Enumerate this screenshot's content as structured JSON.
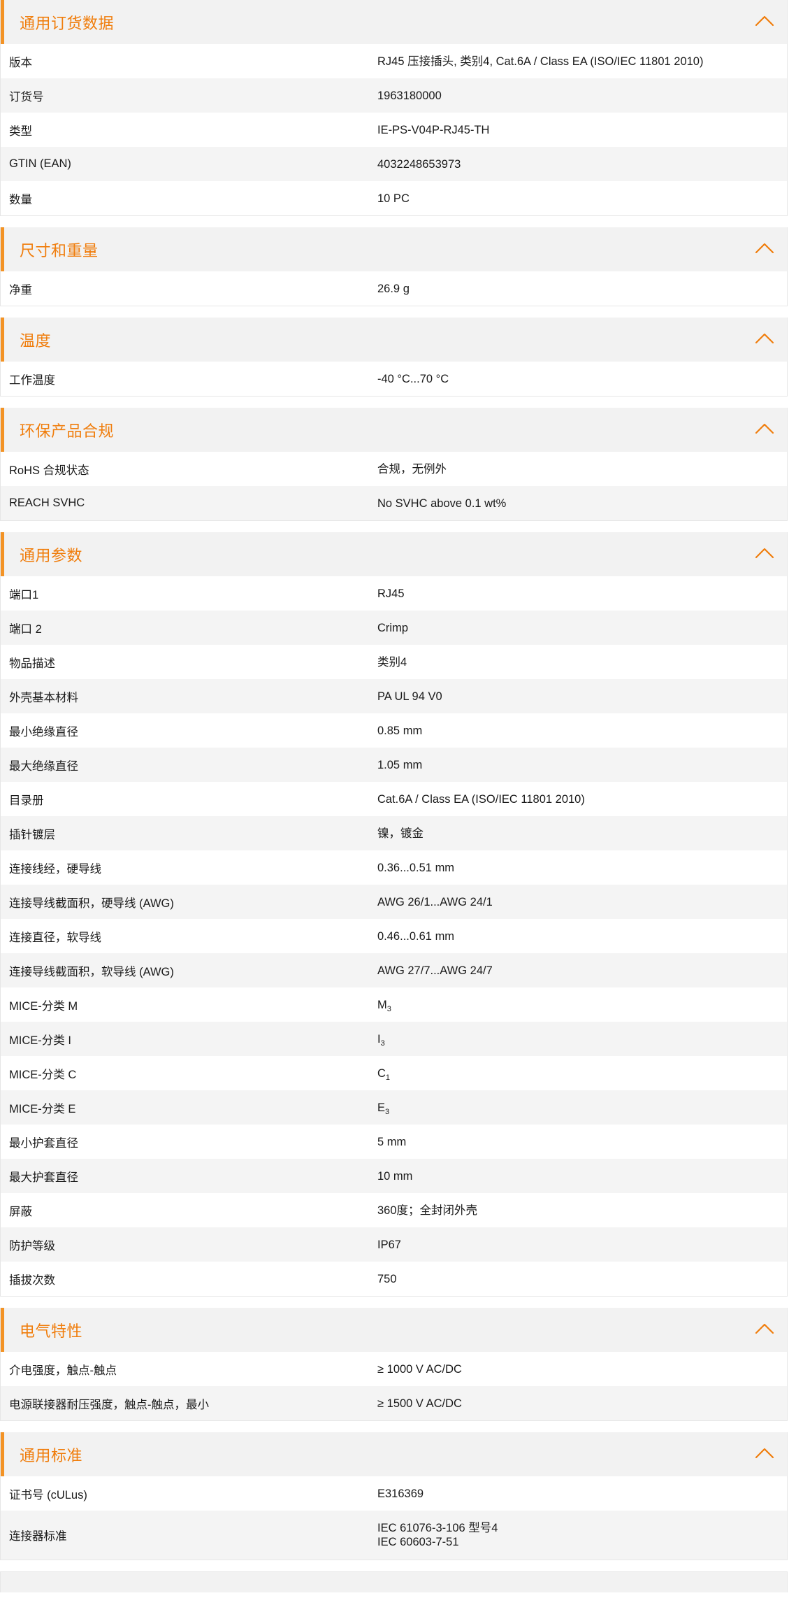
{
  "colors": {
    "accent": "#f39325",
    "title": "#f07d0c",
    "header_bg": "#f2f2f2",
    "row_alt": "#f4f4f4"
  },
  "icons": {
    "collapse": "chevron-up-icon"
  },
  "sections": [
    {
      "title": "通用订货数据",
      "rows": [
        {
          "label": "版本",
          "value": "RJ45 压接插头, 类别4, Cat.6A / Class EA (ISO/IEC 11801 2010)"
        },
        {
          "label": "订货号",
          "value": "1963180000"
        },
        {
          "label": "类型",
          "value": "IE-PS-V04P-RJ45-TH"
        },
        {
          "label": "GTIN (EAN)",
          "value": "4032248653973"
        },
        {
          "label": "数量",
          "value": "10  PC"
        }
      ]
    },
    {
      "title": "尺寸和重量",
      "rows": [
        {
          "label": "净重",
          "value": "26.9  g"
        }
      ]
    },
    {
      "title": "温度",
      "rows": [
        {
          "label": "工作温度",
          "value": "-40 °C...70 °C"
        }
      ]
    },
    {
      "title": "环保产品合规",
      "rows": [
        {
          "label": "RoHS 合规状态",
          "value": "合规，无例外"
        },
        {
          "label": "REACH SVHC",
          "value": "No SVHC above 0.1 wt%"
        }
      ]
    },
    {
      "title": "通用参数",
      "rows": [
        {
          "label": "端口1",
          "value": "RJ45"
        },
        {
          "label": "端口 2",
          "value": "Crimp"
        },
        {
          "label": "物品描述",
          "value": "类别4"
        },
        {
          "label": "外壳基本材料",
          "value": "PA UL 94 V0"
        },
        {
          "label": "最小绝缘直径",
          "value": "0.85  mm"
        },
        {
          "label": "最大绝缘直径",
          "value": "1.05  mm"
        },
        {
          "label": "目录册",
          "value": "Cat.6A / Class EA (ISO/IEC 11801 2010)"
        },
        {
          "label": "插针镀层",
          "value": "镍，镀金"
        },
        {
          "label": "连接线经，硬导线",
          "value": "0.36...0.51 mm"
        },
        {
          "label": "连接导线截面积，硬导线 (AWG)",
          "value": "AWG 26/1...AWG 24/1"
        },
        {
          "label": "连接直径，软导线",
          "value": "0.46...0.61 mm"
        },
        {
          "label": "连接导线截面积，软导线 (AWG)",
          "value": "AWG 27/7...AWG 24/7"
        },
        {
          "label": "MICE-分类 M",
          "value": "M",
          "sub": "3"
        },
        {
          "label": "MICE-分类 I",
          "value": "I",
          "sub": "3"
        },
        {
          "label": "MICE-分类 C",
          "value": "C",
          "sub": "1"
        },
        {
          "label": "MICE-分类 E",
          "value": "E",
          "sub": "3"
        },
        {
          "label": "最小护套直径",
          "value": "5  mm"
        },
        {
          "label": "最大护套直径",
          "value": "10  mm"
        },
        {
          "label": "屏蔽",
          "value": "360度；全封闭外壳"
        },
        {
          "label": "防护等级",
          "value": "IP67"
        },
        {
          "label": "插拔次数",
          "value": "750"
        }
      ]
    },
    {
      "title": "电气特性",
      "rows": [
        {
          "label": "介电强度，触点-触点",
          "value": "≥ 1000 V AC/DC"
        },
        {
          "label": "电源联接器耐压强度，触点-触点，最小",
          "value": "≥ 1500 V AC/DC"
        }
      ]
    },
    {
      "title": "通用标准",
      "rows": [
        {
          "label": "证书号 (cULus)",
          "value": "E316369"
        },
        {
          "label": "连接器标准",
          "lines": [
            "IEC 61076-3-106 型号4",
            "IEC 60603-7-51"
          ]
        }
      ]
    }
  ]
}
